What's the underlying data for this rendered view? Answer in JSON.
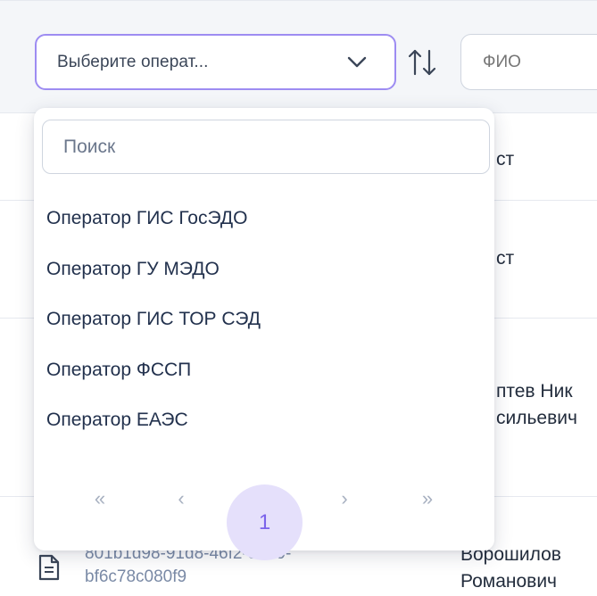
{
  "filter": {
    "operator_select_value": "Выберите операт...",
    "fio_placeholder": "ФИО"
  },
  "table": {
    "rows": [
      {
        "right_text": "ст"
      },
      {
        "right_text": "ст"
      },
      {
        "right_text_line1": "птев Ник",
        "right_text_line2": "сильевич"
      },
      {
        "doc_id_line1": "801b1d98-91d8-46f2-8989-",
        "doc_id_line2": "bf6c78c080f9",
        "name_line1": "Ворошилов",
        "name_line2": "Романович"
      }
    ]
  },
  "dropdown": {
    "search_placeholder": "Поиск",
    "options": [
      "Оператор ГИС ГосЭДО",
      "Оператор ГУ МЭДО",
      "Оператор ГИС ТОР СЭД",
      "Оператор ФССП",
      "Оператор ЕАЭС"
    ],
    "pagination": {
      "first": "«",
      "prev": "‹",
      "current": "1",
      "next": "›",
      "last": "»"
    }
  },
  "colors": {
    "accent": "#9d8cf2",
    "accent_dark": "#7b63ea",
    "accent_soft": "#e5e0fb",
    "text": "#22314d",
    "muted": "#7a8aa6"
  },
  "icons": {
    "chevron": "chevron-down-icon",
    "sort": "sort-arrows-icon",
    "document": "document-icon"
  }
}
